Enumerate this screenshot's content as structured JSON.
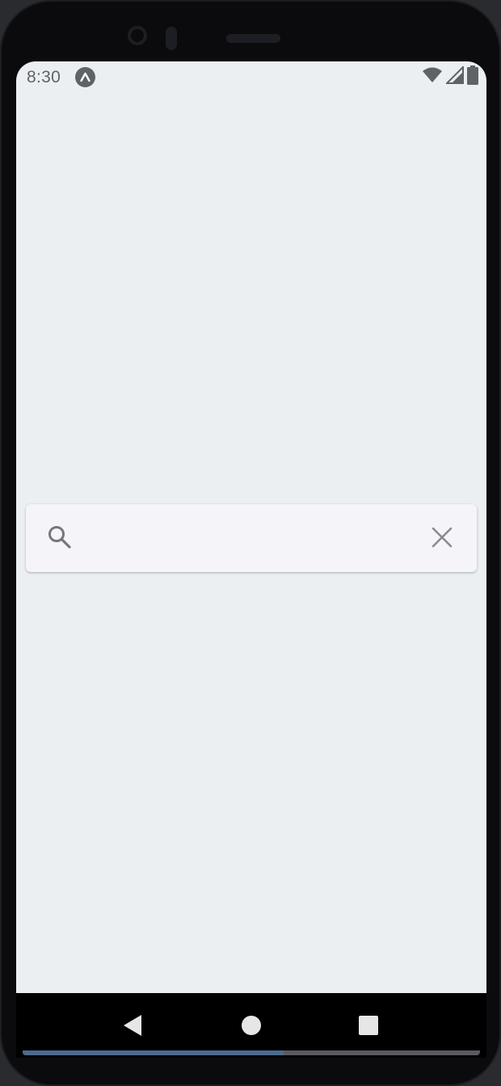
{
  "status_bar": {
    "time": "8:30",
    "app_icon": "expo-icon",
    "icons": [
      "wifi-icon",
      "cell-signal-icon",
      "battery-icon"
    ]
  },
  "search": {
    "placeholder": "",
    "value": "",
    "leading_icon": "search-icon",
    "trailing_icon": "close-icon"
  },
  "nav_bar": {
    "buttons": [
      "back-icon",
      "home-icon",
      "recents-icon"
    ]
  },
  "bottom_progress": {
    "fraction": 0.57
  },
  "colors": {
    "screen_background": "#ebeff2",
    "search_background": "#f5f4f9",
    "icon_gray": "#5f6368",
    "nav_background": "#000000",
    "progress_fill": "#4d6a8e"
  }
}
